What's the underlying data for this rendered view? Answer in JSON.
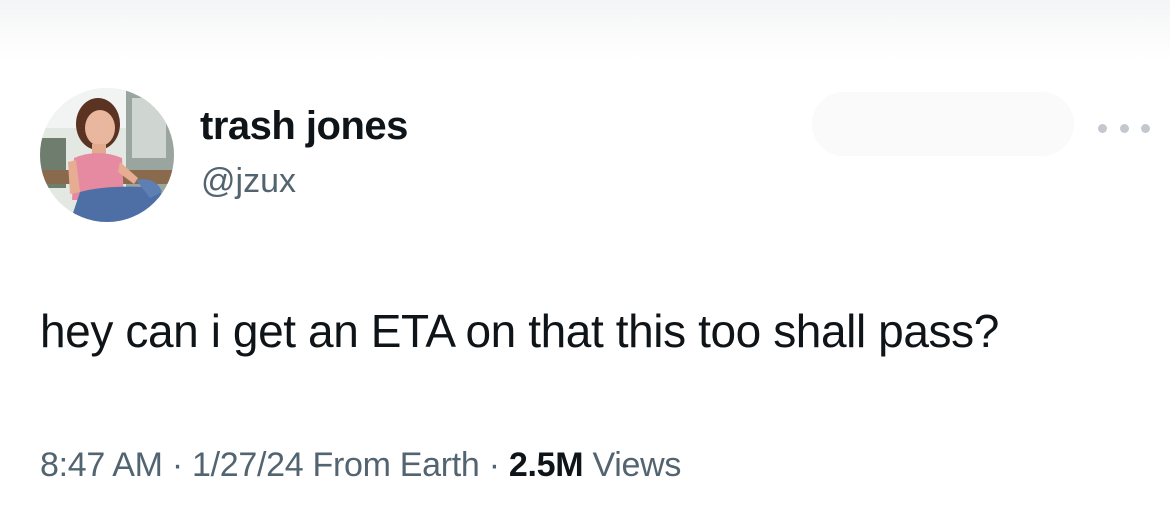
{
  "tweet": {
    "author": {
      "display_name": "trash jones",
      "handle": "@jzux",
      "avatar_icon": "profile-photo"
    },
    "text": "hey can i get an ETA on that this too shall pass?",
    "time": "8:47 AM",
    "separator": "·",
    "date": "1/27/24",
    "source": "From Earth",
    "views_count": "2.5M",
    "views_label": "Views"
  },
  "more_icon": "more-horizontal-icon",
  "colors": {
    "text_primary": "#0f1419",
    "text_secondary": "#536471",
    "icon_muted": "#c2c8cd"
  }
}
